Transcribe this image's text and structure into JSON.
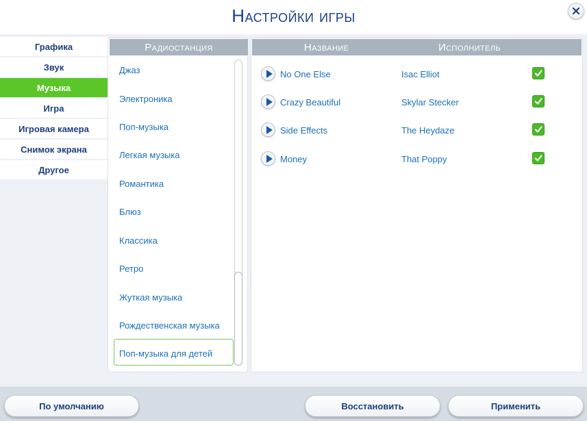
{
  "window": {
    "title": "Настройки игры",
    "close_icon": "close-icon"
  },
  "sidebar": {
    "items": [
      {
        "label": "Графика",
        "active": false
      },
      {
        "label": "Звук",
        "active": false
      },
      {
        "label": "Музыка",
        "active": true
      },
      {
        "label": "Игра",
        "active": false
      },
      {
        "label": "Игровая камера",
        "active": false
      },
      {
        "label": "Снимок экрана",
        "active": false
      },
      {
        "label": "Другое",
        "active": false
      }
    ]
  },
  "stations": {
    "header": "Радиостанция",
    "items": [
      "Джаз",
      "Электроника",
      "Поп-музыка",
      "Легкая музыка",
      "Романтика",
      "Блюз",
      "Классика",
      "Ретро",
      "Жуткая музыка",
      "Рождественская музыка",
      "Поп-музыка для детей"
    ],
    "selected": "Поп-музыка для детей"
  },
  "songs": {
    "name_header": "Название",
    "artist_header": "Исполнитель",
    "rows": [
      {
        "name": "No One Else",
        "artist": "Isac Elliot",
        "enabled": true
      },
      {
        "name": "Crazy Beautiful",
        "artist": "Skylar Stecker",
        "enabled": true
      },
      {
        "name": "Side Effects",
        "artist": "The Heydaze",
        "enabled": true
      },
      {
        "name": "Money",
        "artist": "That Poppy",
        "enabled": true
      }
    ]
  },
  "footer": {
    "defaults_label": "По умолчанию",
    "restore_label": "Восстановить",
    "apply_label": "Применить"
  },
  "colors": {
    "accent_green": "#5bc529",
    "title_blue": "#183f8f",
    "link_blue": "#1c6fb8",
    "header_gray": "#a9b3be"
  }
}
